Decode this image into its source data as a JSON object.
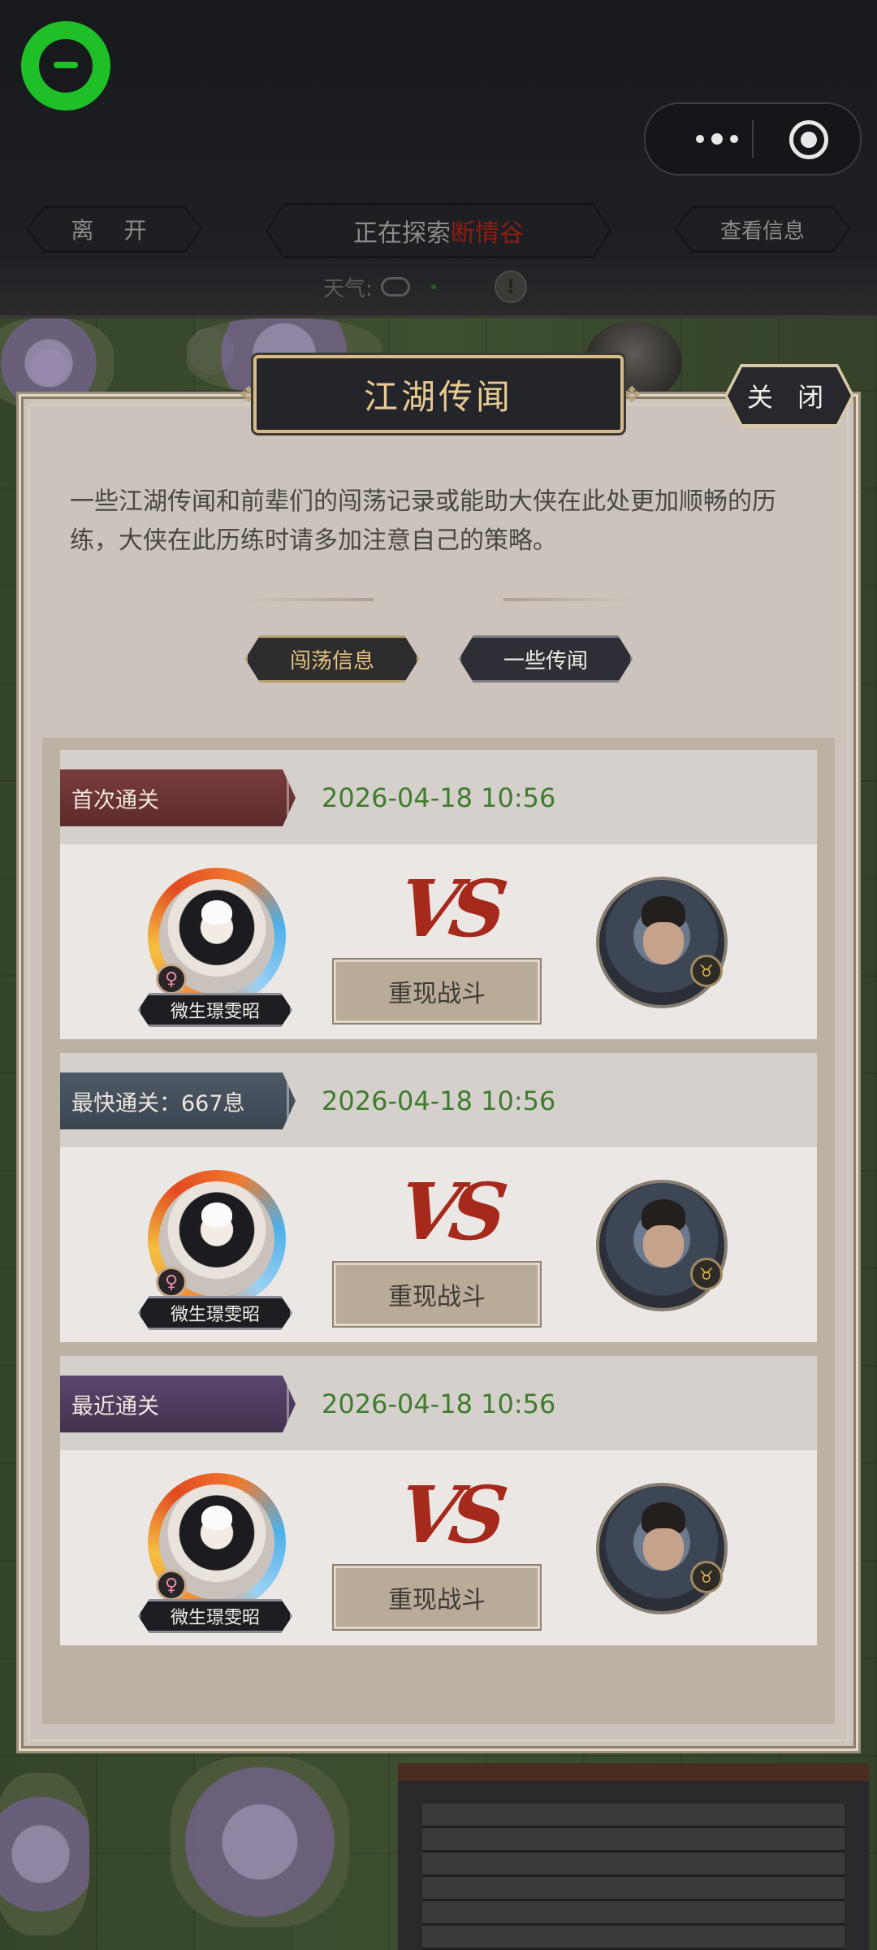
{
  "topbar": {
    "leave_label": "离 开",
    "explore_prefix": "正在探索",
    "explore_location": "断情谷",
    "info_label": "查看信息",
    "weather_label": "天气:",
    "weather_warning": "!"
  },
  "capsule": {
    "more_icon": "more-dots-icon",
    "close_icon": "target-icon"
  },
  "panel": {
    "title": "江湖传闻",
    "close_label": "关 闭",
    "description": "一些江湖传闻和前辈们的闯荡记录或能助大侠在此处更加顺畅的历练，大侠在此历练时请多加注意自己的策略。",
    "tabs": [
      {
        "label": "闯荡信息",
        "active": true
      },
      {
        "label": "一些传闻",
        "active": false
      }
    ]
  },
  "records": [
    {
      "tag": "首次通关",
      "time": "2026-04-18 10:56",
      "hero_name": "微生璟雯昭",
      "gender_symbol": "♀",
      "vs": "VS",
      "replay_label": "重现战斗",
      "tag_color": "#6b3435"
    },
    {
      "tag": "最快通关：667息",
      "time": "2026-04-18 10:56",
      "hero_name": "微生璟雯昭",
      "gender_symbol": "♀",
      "vs": "VS",
      "replay_label": "重现战斗",
      "tag_color": "#44505c"
    },
    {
      "tag": "最近通关",
      "time": "2026-04-18 10:56",
      "hero_name": "微生璟雯昭",
      "gender_symbol": "♀",
      "vs": "VS",
      "replay_label": "重现战斗",
      "tag_color": "#4e3c60"
    }
  ],
  "colors": {
    "accent_gold": "#e8c98f",
    "time_green": "#3e7d2e",
    "vs_red": "#a62a1b",
    "location_red": "#8e1e14"
  }
}
